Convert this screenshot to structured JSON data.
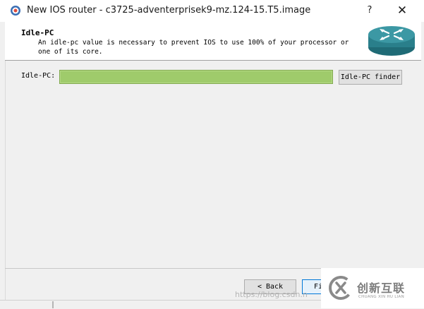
{
  "window": {
    "title": "New IOS router - c3725-adventerprisek9-mz.124-15.T5.image",
    "help_label": "?",
    "close_label": "✕",
    "app_icon": "gns3-icon"
  },
  "header": {
    "title": "Idle-PC",
    "description": "An idle-pc value is necessary to prevent IOS to use 100% of your processor or one of its core.",
    "logo_icon": "router-icon"
  },
  "form": {
    "idlepc_label": "Idle-PC:",
    "idlepc_value": "",
    "finder_button": "Idle-PC finder"
  },
  "footer": {
    "back_button": "< Back",
    "finish_button": "Fi"
  },
  "watermark": {
    "url": "https://blog.csdn.n",
    "brand_name": "创新互联",
    "brand_pinyin": "CHUANG XIN HU LIAN"
  },
  "colors": {
    "input_highlight": "#9fcb6b",
    "router_teal": "#2e8a97",
    "focus_blue": "#0078d7"
  }
}
